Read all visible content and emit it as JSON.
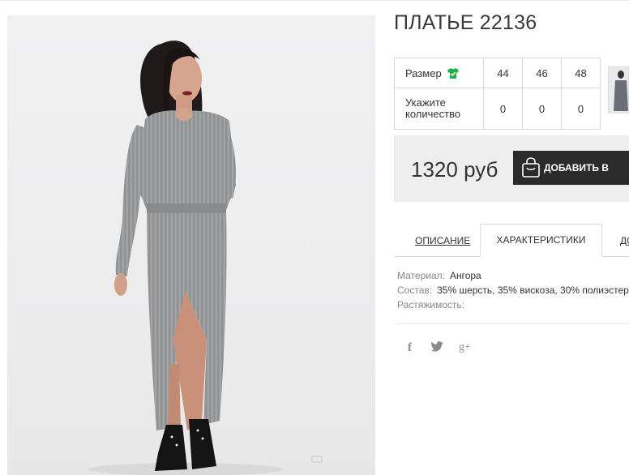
{
  "product": {
    "title": "ПЛАТЬЕ 22136",
    "photo_icon": "product-photo"
  },
  "size_table": {
    "size_label": "Размер",
    "size_icon": "tshirt-check-icon",
    "sizes": [
      "44",
      "46",
      "48"
    ],
    "qty_label": "Укажите количество",
    "quantities": [
      "0",
      "0",
      "0"
    ]
  },
  "price": {
    "value": "1320 руб",
    "button_label": "ДОБАВИТЬ В",
    "button_icon": "shopping-bag-icon"
  },
  "tabs": [
    {
      "label": "ОПИСАНИЕ",
      "active": false
    },
    {
      "label": "ХАРАКТЕРИСТИКИ",
      "active": true
    },
    {
      "label": "ДО",
      "active": false
    }
  ],
  "specs": [
    {
      "key": "Материал:",
      "value": "Ангора"
    },
    {
      "key": "Состав:",
      "value": "35% шерсть, 35% вискоза, 30% полиэстер"
    },
    {
      "key": "Растяжимость:",
      "value": ""
    }
  ],
  "social": {
    "facebook": "f",
    "google_plus": "g+"
  },
  "colors": {
    "accent_green": "#1fb14a",
    "button_bg": "#2b2b2b",
    "price_bar_bg": "#eeeeee"
  }
}
